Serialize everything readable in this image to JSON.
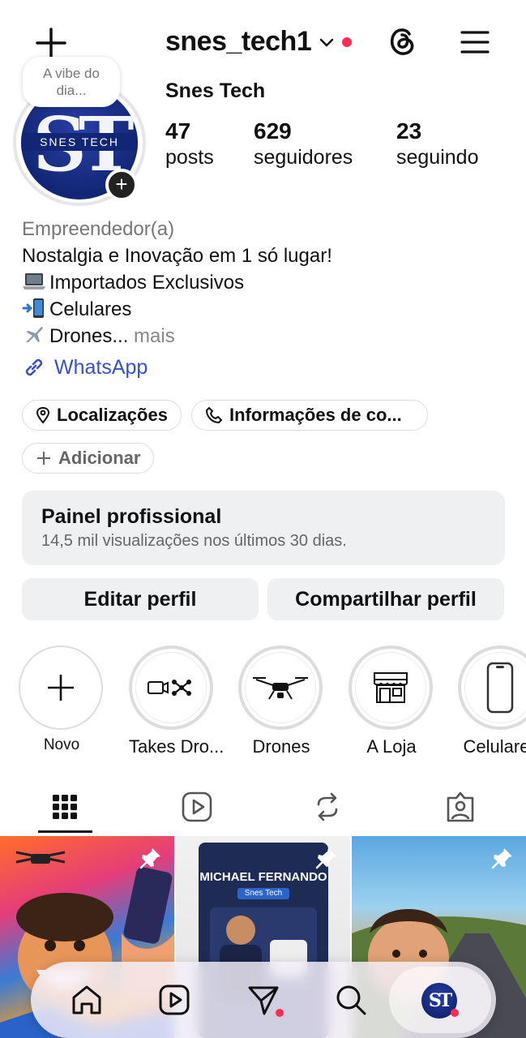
{
  "header": {
    "username": "snes_tech1",
    "note": "A vibe do dia..."
  },
  "profile": {
    "display_name": "Snes Tech",
    "avatar_text": "ST",
    "avatar_band": "SNES TECH",
    "stats": [
      {
        "value": "47",
        "label": "posts"
      },
      {
        "value": "629",
        "label": "seguidores"
      },
      {
        "value": "23",
        "label": "seguindo"
      }
    ]
  },
  "bio": {
    "category": "Empreendedor(a)",
    "line1": "Nostalgia e Inovação em 1 só lugar!",
    "line2": "Importados Exclusivos",
    "line3": "Celulares",
    "line4": "Drones...",
    "more": "mais",
    "link": "WhatsApp"
  },
  "pills": {
    "locations": "Localizações",
    "contact": "Informações de co...",
    "add": "Adicionar"
  },
  "dashboard": {
    "title": "Painel profissional",
    "subtitle": "14,5 mil visualizações nos últimos 30 dias."
  },
  "actions": {
    "edit": "Editar perfil",
    "share": "Compartilhar perfil"
  },
  "highlights": [
    {
      "label": "Novo",
      "icon": "plus-icon"
    },
    {
      "label": "Takes Dro...",
      "icon": "video-drone-icon"
    },
    {
      "label": "Drones",
      "icon": "drone-icon"
    },
    {
      "label": "A Loja",
      "icon": "store-icon"
    },
    {
      "label": "Celulares",
      "icon": "phone-icon"
    }
  ],
  "posts": [
    {
      "label": "",
      "pinned": true
    },
    {
      "label": "MICHAEL FERNANDO",
      "sublabel": "Snes Tech",
      "pinned": true
    },
    {
      "label": "",
      "pinned": true
    }
  ],
  "colors": {
    "link": "#3750c9",
    "notification": "#ff2d55",
    "button_bg": "#eff0f2"
  }
}
